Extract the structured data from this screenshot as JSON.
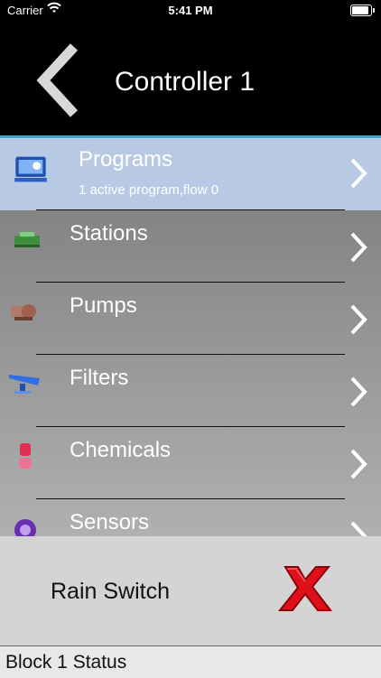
{
  "status_bar": {
    "carrier": "Carrier",
    "time": "5:41 PM"
  },
  "nav": {
    "title": "Controller 1"
  },
  "menu": [
    {
      "label": "Programs",
      "subtitle": "1 active program,flow 0",
      "icon": "programs-icon"
    },
    {
      "label": "Stations",
      "subtitle": "",
      "icon": "stations-icon"
    },
    {
      "label": "Pumps",
      "subtitle": "",
      "icon": "pumps-icon"
    },
    {
      "label": "Filters",
      "subtitle": "",
      "icon": "filters-icon"
    },
    {
      "label": "Chemicals",
      "subtitle": "",
      "icon": "chemicals-icon"
    },
    {
      "label": "Sensors",
      "subtitle": "",
      "icon": "sensors-icon"
    }
  ],
  "rain_switch": {
    "label": "Rain Switch",
    "icon": "x-icon",
    "color": "#e0101a"
  },
  "block_status": {
    "label": "Block 1 Status"
  },
  "colors": {
    "nav_bg": "#000000",
    "selected_row": "#b8c9e4",
    "accent_line": "#3fa7d6"
  }
}
